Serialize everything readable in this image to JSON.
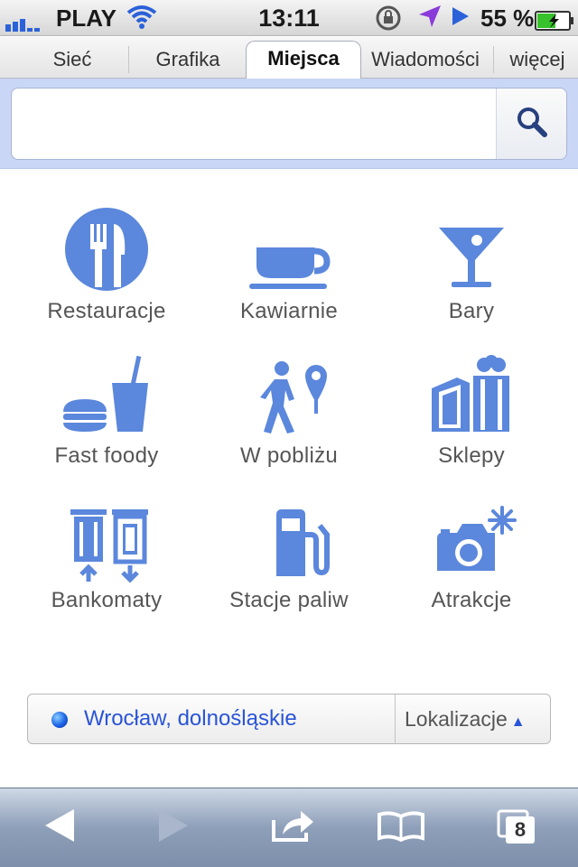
{
  "status": {
    "carrier": "PLAY",
    "time": "13:11",
    "battery": "55 %"
  },
  "tabs": [
    {
      "label": "Sieć"
    },
    {
      "label": "Grafika"
    },
    {
      "label": "Miejsca"
    },
    {
      "label": "Wiadomości"
    },
    {
      "label": "więcej"
    }
  ],
  "search": {
    "value": "",
    "placeholder": ""
  },
  "categories": [
    {
      "label": "Restauracje",
      "icon": "restaurant-icon"
    },
    {
      "label": "Kawiarnie",
      "icon": "cafe-icon"
    },
    {
      "label": "Bary",
      "icon": "bar-icon"
    },
    {
      "label": "Fast foody",
      "icon": "fast-food-icon"
    },
    {
      "label": "W pobliżu",
      "icon": "nearby-icon"
    },
    {
      "label": "Sklepy",
      "icon": "shops-icon"
    },
    {
      "label": "Bankomaty",
      "icon": "atm-icon"
    },
    {
      "label": "Stacje paliw",
      "icon": "gas-station-icon"
    },
    {
      "label": "Atrakcje",
      "icon": "attractions-icon"
    }
  ],
  "location": {
    "text": "Wrocław, dolnośląskie",
    "button_label": "Lokalizacje"
  },
  "toolbar": {
    "tabs_count": "8"
  },
  "colors": {
    "icon_blue": "#5b87dc",
    "link_blue": "#2a54d8",
    "search_band": "#c9d6f5"
  }
}
